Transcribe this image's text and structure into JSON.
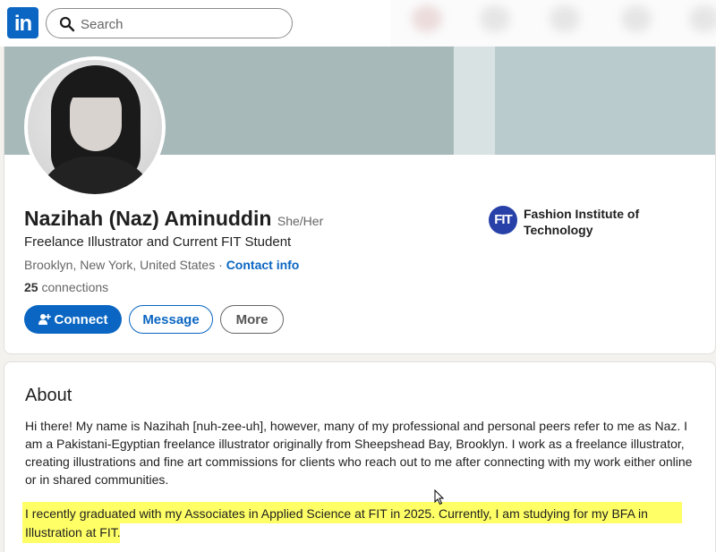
{
  "topbar": {
    "logo_text": "in",
    "search_placeholder": "Search"
  },
  "profile": {
    "name": "Nazihah (Naz) Aminuddin",
    "pronouns": "She/Her",
    "headline": "Freelance Illustrator and Current FIT Student",
    "location": "Brooklyn, New York, United States",
    "separator": " · ",
    "contact_info": "Contact info",
    "connections_count": "25",
    "connections_label": " connections",
    "education": {
      "badge": "FIT",
      "name": "Fashion Institute of Technology"
    },
    "buttons": {
      "connect": "Connect",
      "message": "Message",
      "more": "More"
    }
  },
  "about": {
    "title": "About",
    "paragraph1": "Hi there! My name is Nazihah [nuh-zee-uh], however, many of my professional and personal peers refer to me as Naz. I am a Pakistani-Egyptian freelance illustrator originally from Sheepshead Bay, Brooklyn. I work as a freelance illustrator, creating illustrations and fine art commissions for clients who reach out to me after connecting with my work either online or in shared communities.",
    "paragraph2": "I recently graduated with my Associates in Applied Science at FIT in 2025. Currently, I am studying for my BFA in Illustration at FIT."
  },
  "colors": {
    "brand": "#0a66c2",
    "highlight": "#ffff66",
    "banner": "#a8b9ba"
  }
}
